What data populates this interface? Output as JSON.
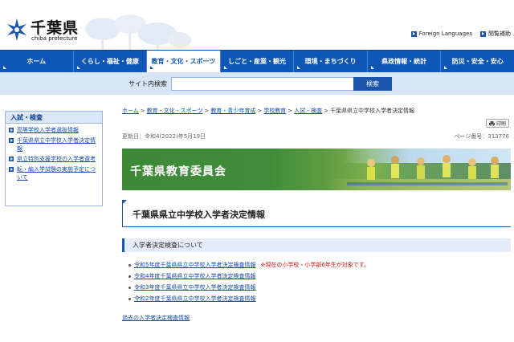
{
  "header": {
    "logo_title": "千葉県",
    "logo_subtitle": "chiba prefecture",
    "links": [
      {
        "label": "Foreign Languages"
      },
      {
        "label": "閲覧補助"
      }
    ]
  },
  "nav": {
    "items": [
      {
        "label": "ホーム"
      },
      {
        "label": "くらし・福祉・健康"
      },
      {
        "label": "教育・文化・スポーツ"
      },
      {
        "label": "しごと・産業・観光"
      },
      {
        "label": "環境・まちづくり"
      },
      {
        "label": "県政情報・統計"
      },
      {
        "label": "防災・安全・安心"
      }
    ]
  },
  "search": {
    "label": "サイト内検索",
    "placeholder": "",
    "button": "検索"
  },
  "sidebar": {
    "title": "入試・検査",
    "items": [
      {
        "label": "高等学校入学者選抜情報"
      },
      {
        "label": "千葉県県立中学校入学者決定情報"
      },
      {
        "label": "県立特別支援学校の入学者選考"
      },
      {
        "label": "転・編入学試験の実施予定について"
      }
    ]
  },
  "breadcrumb": {
    "items": [
      {
        "label": "ホーム"
      },
      {
        "label": "教育・文化・スポーツ"
      },
      {
        "label": "教育・青少年育成"
      },
      {
        "label": "学校教育"
      },
      {
        "label": "入試・検査"
      }
    ],
    "separator": ">",
    "current": "千葉県県立中学校入学者決定情報"
  },
  "print_label": "印刷",
  "update_date": "更新日：令和4(2022)年5月19日",
  "page_number": "ページ番号：313776",
  "banner_title": "千葉県教育委員会",
  "page_title": "千葉県県立中学校入学者決定情報",
  "section_title": "入学者決定検査について",
  "links": [
    {
      "label": "令和5年度千葉県県立中学校入学者決定検査情報",
      "note": "※現在の小学校・小学部6年生が対象です。"
    },
    {
      "label": "令和4年度千葉県県立中学校入学者決定検査情報",
      "note": ""
    },
    {
      "label": "令和3年度千葉県県立中学校入学者決定検査情報",
      "note": ""
    },
    {
      "label": "令和2年度千葉県県立中学校入学者決定検査情報",
      "note": ""
    }
  ],
  "past_link": "過去の入学者決定検査情報",
  "colors": {
    "nav_blue": "#0f57b6",
    "search_bg": "#d7e5f6",
    "notice_red": "#d21616",
    "banner_green": "#3d8a38"
  }
}
